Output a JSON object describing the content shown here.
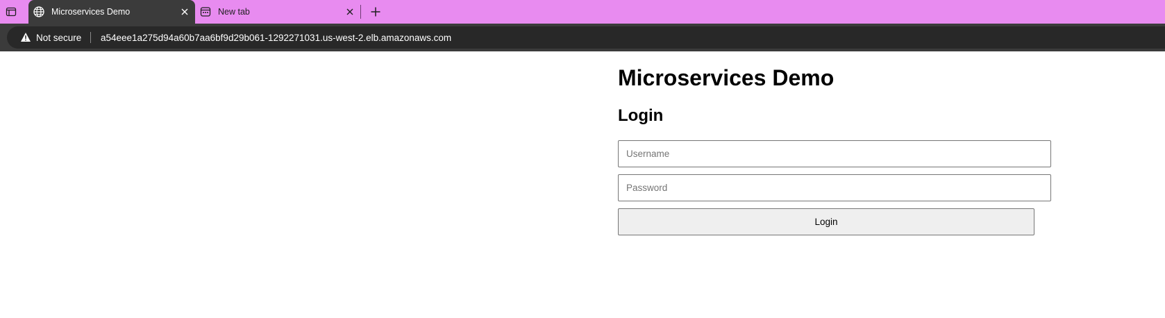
{
  "browser": {
    "tabs": [
      {
        "title": "Microservices Demo",
        "icon": "globe-icon",
        "active": true
      },
      {
        "title": "New tab",
        "icon": "new-tab-page-icon",
        "active": false
      }
    ],
    "address_bar": {
      "security_label": "Not secure",
      "url": "a54eee1a275d94a60b7aa6bf9d29b061-1292271031.us-west-2.elb.amazonaws.com"
    },
    "colors": {
      "tabstrip": "#e88bf0",
      "active_tab": "#3b3b3b",
      "omnibox": "#282828"
    }
  },
  "page": {
    "title": "Microservices Demo",
    "login_heading": "Login",
    "username_placeholder": "Username",
    "password_placeholder": "Password",
    "login_button": "Login"
  }
}
